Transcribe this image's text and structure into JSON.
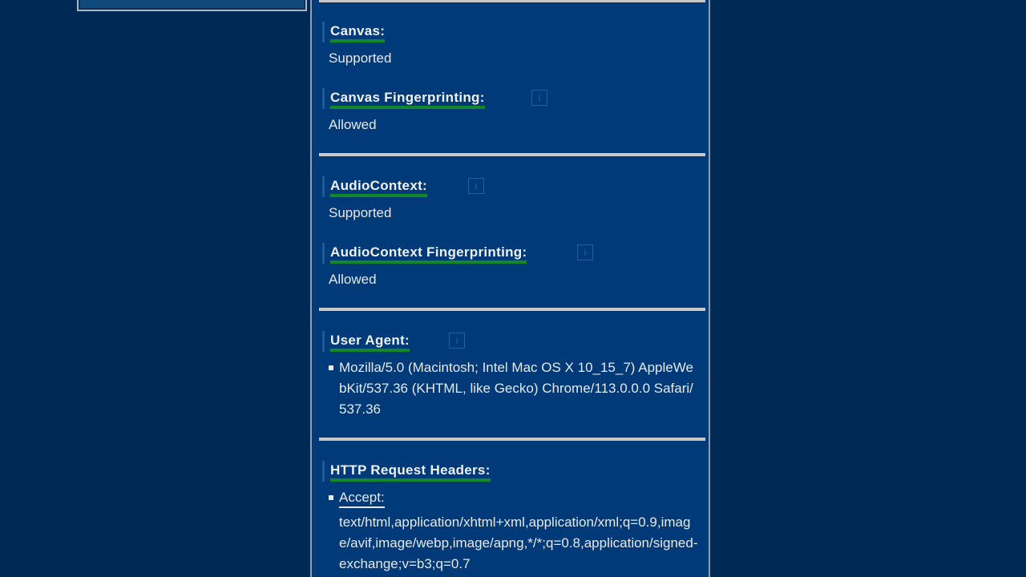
{
  "sections": {
    "canvas": {
      "label": "Canvas:",
      "value": "Supported"
    },
    "canvas_fp": {
      "label": "Canvas Fingerprinting:",
      "value": "Allowed",
      "icon": "i"
    },
    "audio": {
      "label": "AudioContext:",
      "value": "Supported",
      "icon": "i"
    },
    "audio_fp": {
      "label": "AudioContext Fingerprinting:",
      "value": "Allowed",
      "icon": "i"
    },
    "user_agent": {
      "label": "User Agent:",
      "icon": "i",
      "value": "Mozilla/5.0 (Macintosh; Intel Mac OS X 10_15_7) AppleWebKit/537.36 (KHTML, like Gecko) Chrome/113.0.0.0 Safari/537.36"
    },
    "http_headers": {
      "label": "HTTP Request Headers:",
      "accept_label": "Accept:",
      "accept_value": "text/html,application/xhtml+xml,application/xml;q=0.9,image/avif,image/webp,image/apng,*/*;q=0.8,application/signed-exchange;v=b3;q=0.7"
    }
  },
  "colors": {
    "background": "#002a55",
    "panel": "#003a78",
    "underline_accent": "#12882a",
    "divider": "#c8c8c8"
  }
}
